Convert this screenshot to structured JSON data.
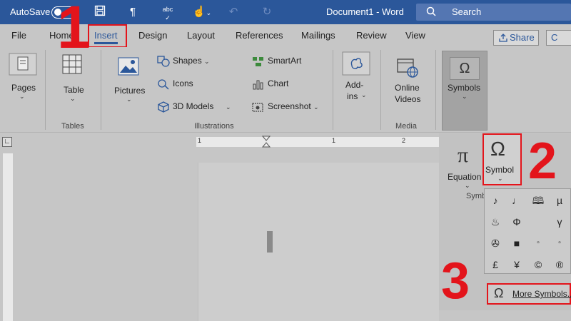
{
  "title_bar": {
    "autosave_label": "AutoSave",
    "toggle_state": "Off",
    "document_title": "Document1 - Word",
    "search_placeholder": "Search",
    "quick_access_icons": [
      "save-icon",
      "paragraph-icon",
      "spelling-icon",
      "touch-mode-icon",
      "undo-icon",
      "redo-icon"
    ]
  },
  "tabs": {
    "file": "File",
    "home": "Home",
    "insert": "Insert",
    "design": "Design",
    "layout": "Layout",
    "references": "References",
    "mailings": "Mailings",
    "review": "Review",
    "view": "View",
    "share": "Share",
    "comments_partial": "C"
  },
  "ribbon": {
    "pages": "Pages",
    "table": "Table",
    "tables_group": "Tables",
    "pictures": "Pictures",
    "shapes": "Shapes",
    "icons": "Icons",
    "models_3d": "3D Models",
    "smartart": "SmartArt",
    "chart": "Chart",
    "screenshot": "Screenshot",
    "illustrations_group": "Illustrations",
    "addins_line1": "Add-",
    "addins_line2": "ins",
    "online_videos_line1": "Online",
    "online_videos_line2": "Videos",
    "media_group": "Media",
    "symbols": "Symbols"
  },
  "ruler": {
    "numbers": [
      "1",
      "1",
      "2"
    ]
  },
  "symbols_dropdown": {
    "equation": "Equation",
    "symbol": "Symbol",
    "group_partial": "Symb",
    "grid": [
      "♪",
      "♩",
      "🕮",
      "µ",
      "♨",
      "Φ",
      "",
      "γ",
      "✇",
      "■",
      "▫",
      "▫",
      "£",
      "¥",
      "©",
      "®"
    ],
    "more_symbols": "More Symbols..."
  },
  "annotations": {
    "step1": "1",
    "step2": "2",
    "step3": "3",
    "highlight_color": "#e3141b"
  },
  "colors": {
    "word_blue": "#2b579a",
    "overlay_gray": "#c6c6c6"
  }
}
